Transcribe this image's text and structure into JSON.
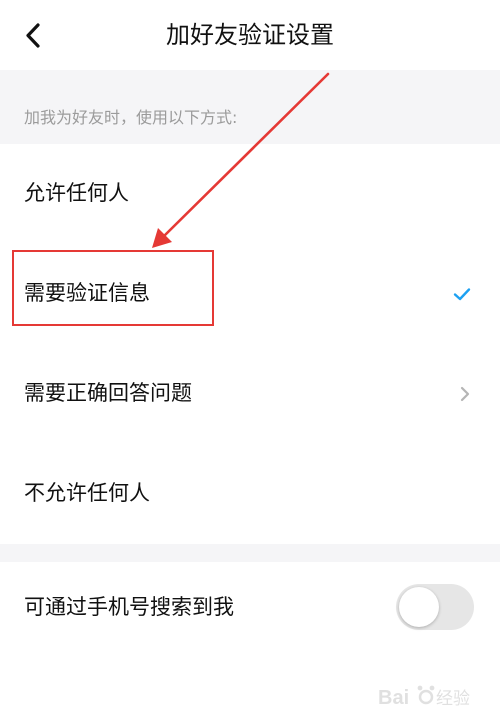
{
  "header": {
    "title": "加好友验证设置"
  },
  "section": {
    "description": "加我为好友时，使用以下方式:"
  },
  "options": [
    {
      "label": "允许任何人"
    },
    {
      "label": "需要验证信息"
    },
    {
      "label": "需要正确回答问题"
    },
    {
      "label": "不允许任何人"
    }
  ],
  "selected_option": "需要验证信息",
  "phone_search": {
    "label": "可通过手机号搜索到我",
    "enabled": false
  },
  "colors": {
    "accent": "#1da1f2",
    "annotation": "#e53935",
    "toggle_off": "#e6e6e6"
  },
  "icons": {
    "back": "chevron-left-icon",
    "check": "check-icon",
    "forward": "chevron-right-icon"
  }
}
